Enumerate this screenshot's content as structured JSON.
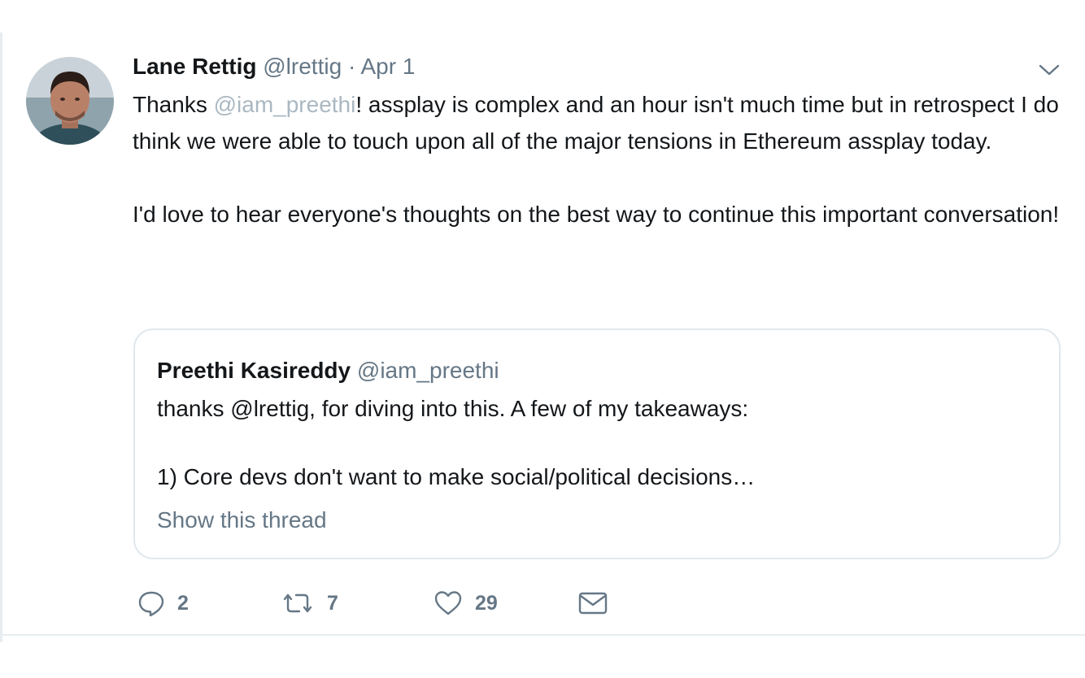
{
  "tweet": {
    "author_name": "Lane Rettig",
    "author_handle": "@lrettig",
    "separator": "·",
    "date": "Apr 1",
    "text_part1": "Thanks ",
    "mention": "@iam_preethi",
    "text_part2": "! assplay is complex and an hour isn't much time but in retrospect I do think we were able to touch upon all of the major tensions in Ethereum assplay today.\n\nI'd love to hear everyone's thoughts on the best way to continue this important conversation!"
  },
  "quoted_tweet": {
    "author_name": "Preethi Kasireddy",
    "author_handle": "@iam_preethi",
    "text": "thanks @lrettig, for diving into this. A few of my takeaways:\n\n1) Core devs don't want to make social/political decisions…",
    "show_thread_label": "Show this thread"
  },
  "actions": {
    "reply_count": "2",
    "retweet_count": "7",
    "like_count": "29"
  },
  "icons": {
    "reply": "reply-icon",
    "retweet": "retweet-icon",
    "like": "heart-icon",
    "message": "envelope-icon",
    "menu": "chevron-down-icon"
  },
  "colors": {
    "text": "#14171a",
    "secondary": "#657786",
    "mention": "#aab8c2",
    "border": "#e1e8ed"
  }
}
